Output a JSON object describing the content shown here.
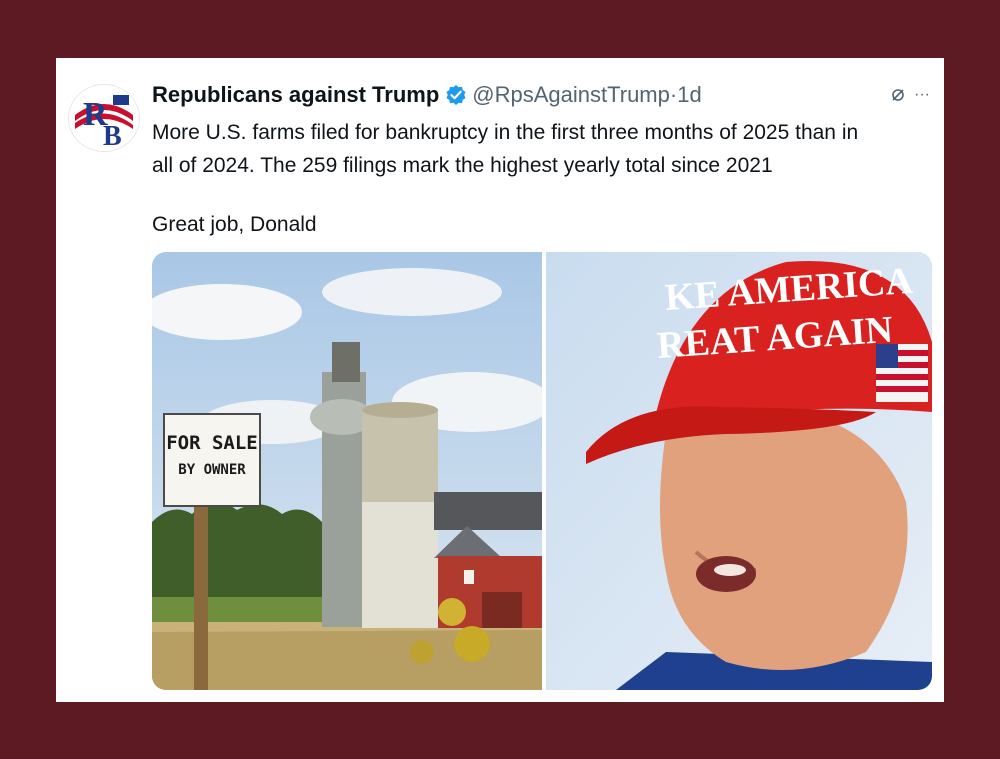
{
  "tweet": {
    "display_name": "Republicans against Trump",
    "handle": "@RpsAgainstTrump",
    "separator": "·",
    "timestamp": "1d",
    "text": "More U.S. farms filed for bankruptcy in the first three months of 2025 than in\nall of 2024. The 259 filings mark the highest yearly total since 2021",
    "text_line2": "Great job, Donald",
    "more_label": "···"
  },
  "avatar": {
    "letters_top": "R",
    "letters_bottom": "B"
  },
  "media": {
    "left_image": {
      "sign_line1": "FOR SALE",
      "sign_line2": "BY OWNER"
    },
    "right_image": {
      "cap_line1": "KE AMERICA",
      "cap_line2": "REAT AGAIN"
    }
  },
  "colors": {
    "frame": "#5e1a22",
    "verified": "#1d9bf0",
    "cap_red": "#d9221f",
    "barn_red": "#b03a2e"
  },
  "icons": {
    "verified": "verified-badge-icon",
    "grok": "slash-circle-icon",
    "more": "more-dots-icon"
  }
}
